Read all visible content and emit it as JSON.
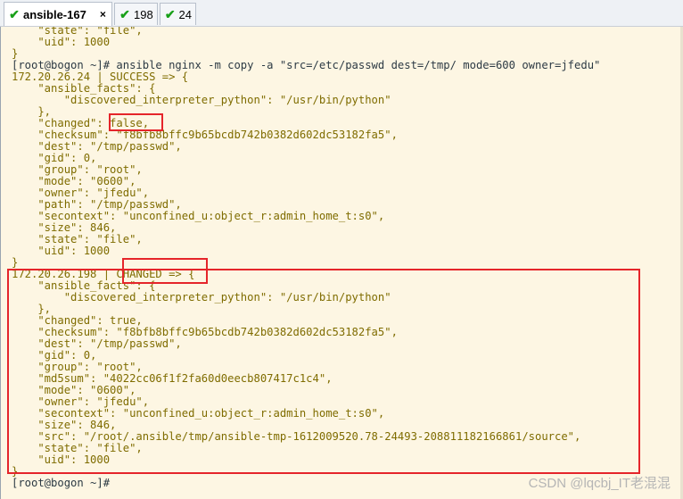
{
  "tabs": [
    {
      "label": "ansible-167",
      "icon": "check-icon",
      "active": true,
      "close": "×"
    },
    {
      "label": "198",
      "icon": "check-icon",
      "active": false
    },
    {
      "label": "24",
      "icon": "check-icon",
      "active": false
    }
  ],
  "terminal": {
    "lines": [
      "    \"state\": \"file\",",
      "    \"uid\": 1000",
      "}",
      "[root@bogon ~]# ansible nginx -m copy -a \"src=/etc/passwd dest=/tmp/ mode=600 owner=jfedu\"",
      "172.20.26.24 | SUCCESS => {",
      "    \"ansible_facts\": {",
      "        \"discovered_interpreter_python\": \"/usr/bin/python\"",
      "    },",
      "    \"changed\": false,",
      "    \"checksum\": \"f8bfb8bffc9b65bcdb742b0382d602dc53182fa5\",",
      "    \"dest\": \"/tmp/passwd\",",
      "    \"gid\": 0,",
      "    \"group\": \"root\",",
      "    \"mode\": \"0600\",",
      "    \"owner\": \"jfedu\",",
      "    \"path\": \"/tmp/passwd\",",
      "    \"secontext\": \"unconfined_u:object_r:admin_home_t:s0\",",
      "    \"size\": 846,",
      "    \"state\": \"file\",",
      "    \"uid\": 1000",
      "}",
      "172.20.26.198 | CHANGED => {",
      "    \"ansible_facts\": {",
      "        \"discovered_interpreter_python\": \"/usr/bin/python\"",
      "    },",
      "    \"changed\": true,",
      "    \"checksum\": \"f8bfb8bffc9b65bcdb742b0382d602dc53182fa5\",",
      "    \"dest\": \"/tmp/passwd\",",
      "    \"gid\": 0,",
      "    \"group\": \"root\",",
      "    \"md5sum\": \"4022cc06f1f2fa60d0eecb807417c1c4\",",
      "    \"mode\": \"0600\",",
      "    \"owner\": \"jfedu\",",
      "    \"secontext\": \"unconfined_u:object_r:admin_home_t:s0\",",
      "    \"size\": 846,",
      "    \"src\": \"/root/.ansible/tmp/ansible-tmp-1612009520.78-24493-208811182166861/source\",",
      "    \"state\": \"file\",",
      "    \"uid\": 1000",
      "}",
      "[root@bogon ~]#"
    ]
  },
  "watermark": "CSDN @lqcbj_IT老混混",
  "colors": {
    "background": "#fdf6e3",
    "output_text": "#7f6c00",
    "prompt_text": "#2c3a44",
    "annotation": "#e5252a",
    "tab_check": "#19a019"
  }
}
